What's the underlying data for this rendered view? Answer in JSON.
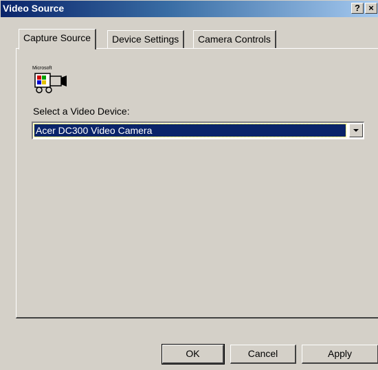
{
  "window": {
    "title": "Video Source",
    "help_label": "?",
    "close_label": "×"
  },
  "tabs": [
    {
      "label": "Capture Source",
      "active": true
    },
    {
      "label": "Device Settings",
      "active": false
    },
    {
      "label": "Camera Controls",
      "active": false
    }
  ],
  "capture_source": {
    "logo_icon": "microsoft-video-camera-icon",
    "logo_text": "Microsoft",
    "device_label": "Select a Video Device:",
    "device_selected": "Acer DC300 Video Camera"
  },
  "buttons": {
    "ok": "OK",
    "cancel": "Cancel",
    "apply": "Apply"
  },
  "colors": {
    "title_start": "#0a246a",
    "face": "#d4d0c8",
    "selection": "#0a246a"
  }
}
